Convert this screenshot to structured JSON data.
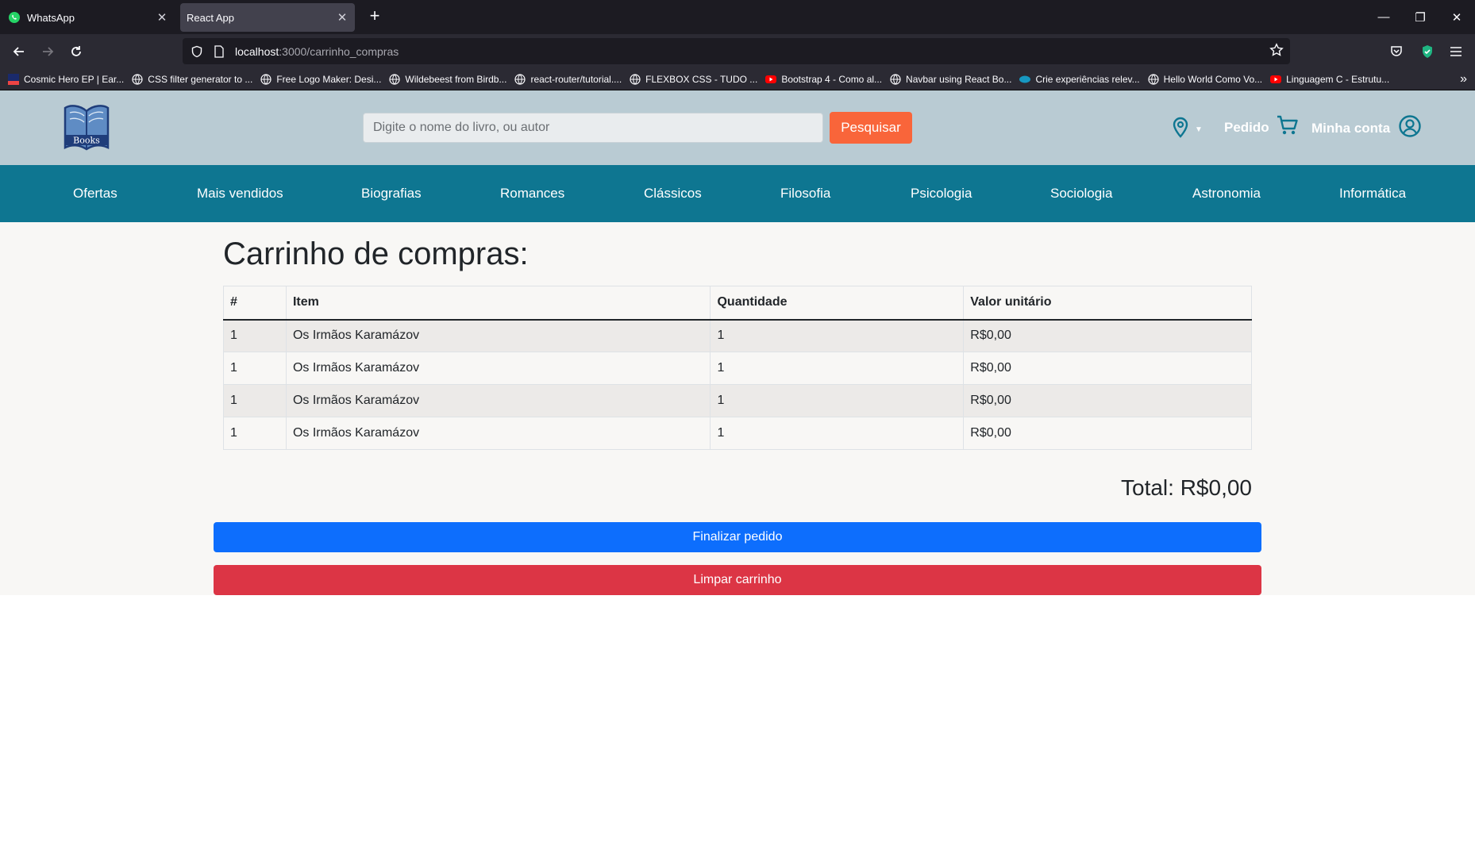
{
  "browser": {
    "tabs": [
      {
        "title": "WhatsApp",
        "active": false
      },
      {
        "title": "React App",
        "active": true
      }
    ],
    "url_host": "localhost",
    "url_path": ":3000/carrinho_compras",
    "bookmarks": [
      "Cosmic Hero EP | Ear...",
      "CSS filter generator to ...",
      "Free Logo Maker: Desi...",
      "Wildebeest from Birdb...",
      "react-router/tutorial....",
      "FLEXBOX CSS - TUDO ...",
      "Bootstrap 4 - Como al...",
      "Navbar using React Bo...",
      "Crie experiências relev...",
      "Hello World Como Vo...",
      "Linguagem C - Estrutu..."
    ]
  },
  "header": {
    "logo_text": "Books",
    "search_placeholder": "Digite o nome do livro, ou autor",
    "search_button": "Pesquisar",
    "order_label": "Pedido",
    "account_label": "Minha conta"
  },
  "categories": [
    "Ofertas",
    "Mais vendidos",
    "Biografias",
    "Romances",
    "Clássicos",
    "Filosofia",
    "Psicologia",
    "Sociologia",
    "Astronomia",
    "Informática"
  ],
  "cart": {
    "title": "Carrinho de compras:",
    "columns": [
      "#",
      "Item",
      "Quantidade",
      "Valor unitário"
    ],
    "rows": [
      [
        "1",
        "Os Irmãos Karamázov",
        "1",
        "R$0,00"
      ],
      [
        "1",
        "Os Irmãos Karamázov",
        "1",
        "R$0,00"
      ],
      [
        "1",
        "Os Irmãos Karamázov",
        "1",
        "R$0,00"
      ],
      [
        "1",
        "Os Irmãos Karamázov",
        "1",
        "R$0,00"
      ]
    ],
    "total": "Total: R$0,00",
    "finish_button": "Finalizar pedido",
    "clear_button": "Limpar carrinho"
  },
  "colors": {
    "header_bg": "#b9cbd3",
    "nav_bg": "#0e7691",
    "search_btn": "#f9653a",
    "primary": "#0d6efd",
    "danger": "#dc3545"
  }
}
